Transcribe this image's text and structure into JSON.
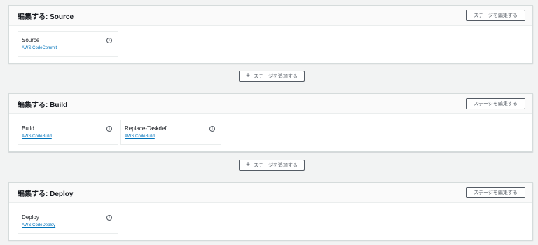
{
  "stages": [
    {
      "title": "編集する: Source",
      "edit_label": "ステージを編集する",
      "actions": [
        {
          "name": "Source",
          "provider": "AWS CodeCommit"
        }
      ]
    },
    {
      "title": "編集する: Build",
      "edit_label": "ステージを編集する",
      "actions": [
        {
          "name": "Build",
          "provider": "AWS CodeBuild"
        },
        {
          "name": "Replace-Taskdef",
          "provider": "AWS CodeBuild"
        }
      ]
    },
    {
      "title": "編集する: Deploy",
      "edit_label": "ステージを編集する",
      "actions": [
        {
          "name": "Deploy",
          "provider": "AWS CodeDeploy"
        }
      ]
    }
  ],
  "add_stage_buttons": [
    {
      "label": "ステージを追加する"
    },
    {
      "label": "ステージを追加する"
    }
  ],
  "icons": {
    "info": "info-icon",
    "plus": "plus-icon"
  },
  "colors": {
    "background": "#f2f3f3",
    "link": "#0073bb",
    "border": "#545b64"
  }
}
